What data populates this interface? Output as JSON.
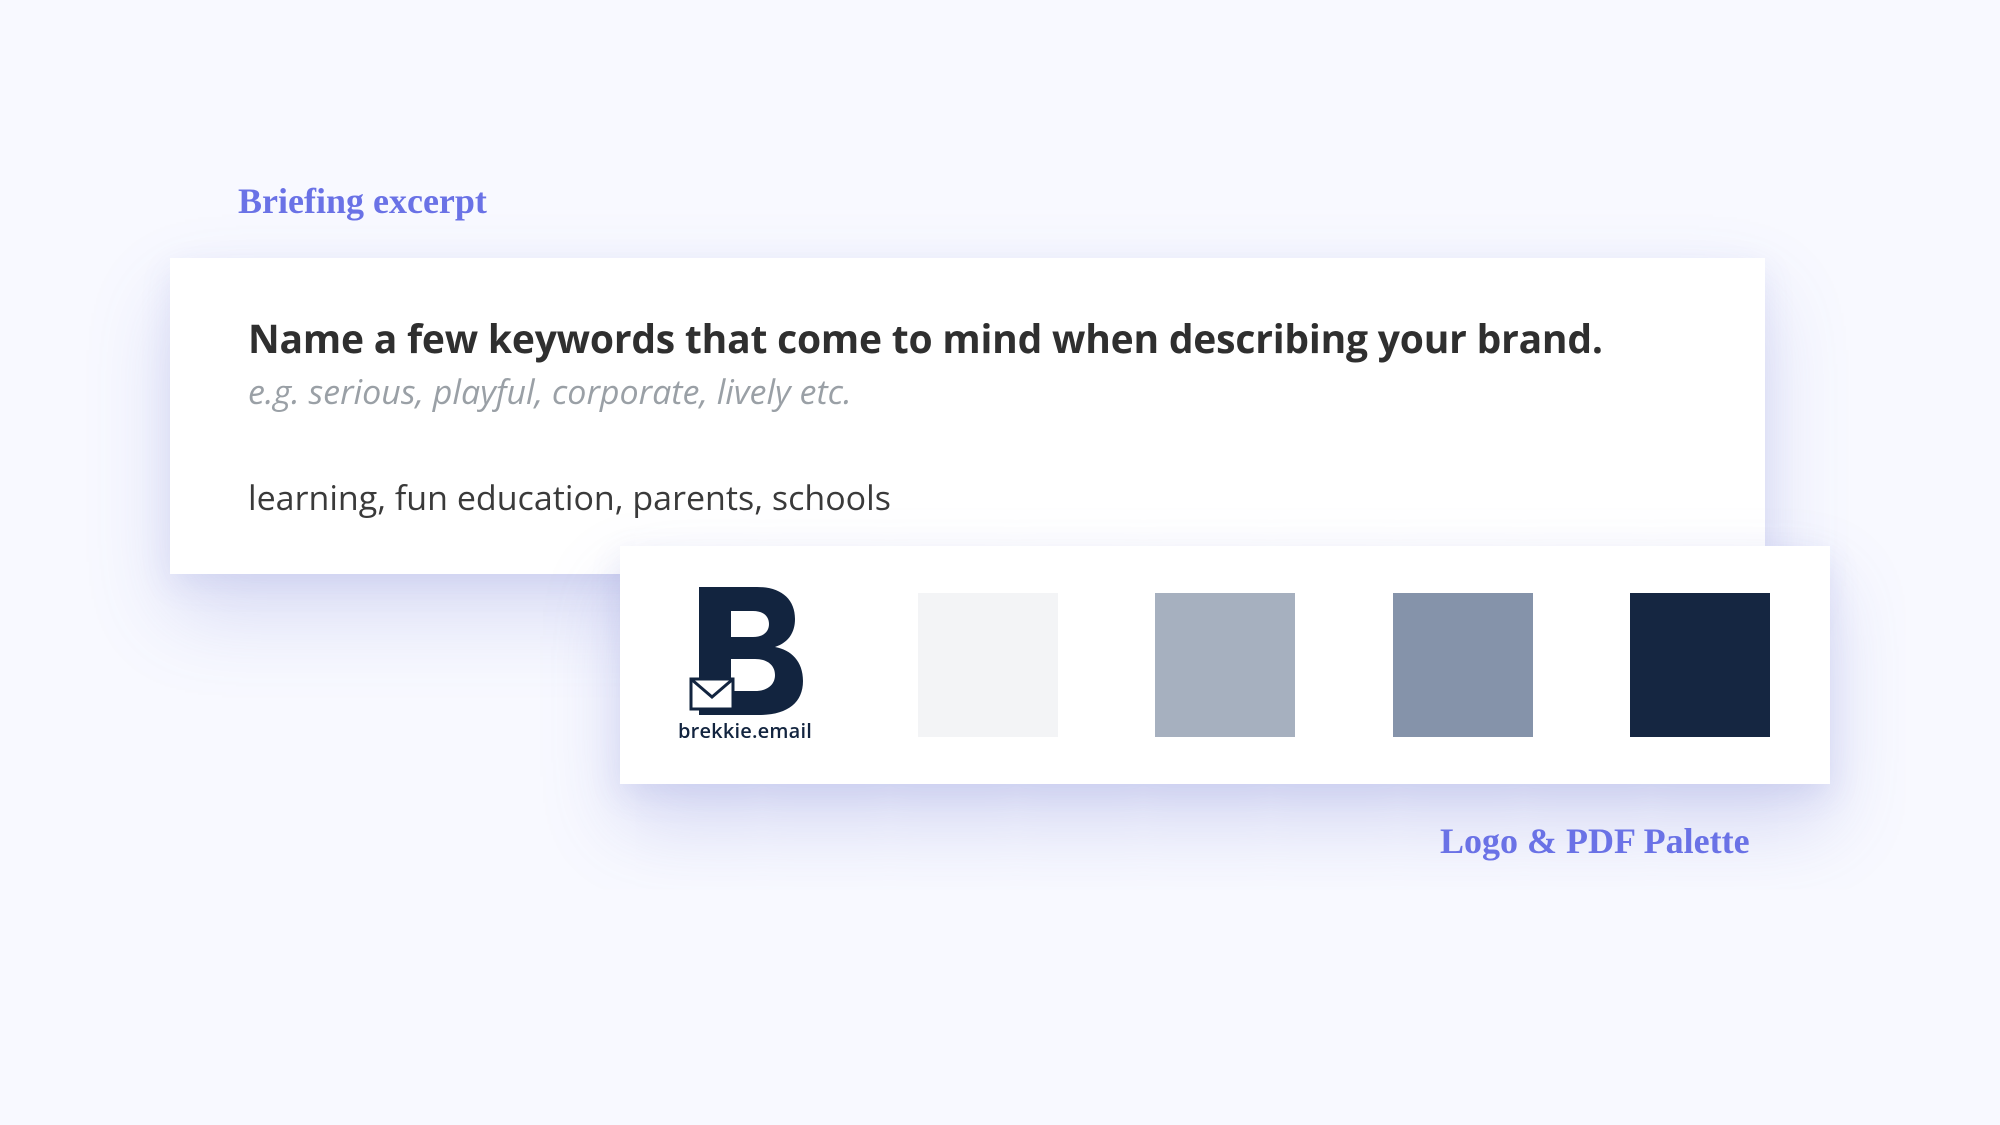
{
  "labels": {
    "briefing": "Briefing excerpt",
    "palette": "Logo & PDF Palette"
  },
  "briefing": {
    "question": "Name a few keywords that come to mind when describing your brand.",
    "hint": "e.g. serious, playful, corporate, lively etc.",
    "answer": "learning, fun education, parents, schools"
  },
  "logo": {
    "text": "brekkie.email",
    "color": "#12243f"
  },
  "palette": {
    "swatches": [
      "#f3f4f6",
      "#a6b0bf",
      "#8593aa",
      "#152641"
    ]
  }
}
